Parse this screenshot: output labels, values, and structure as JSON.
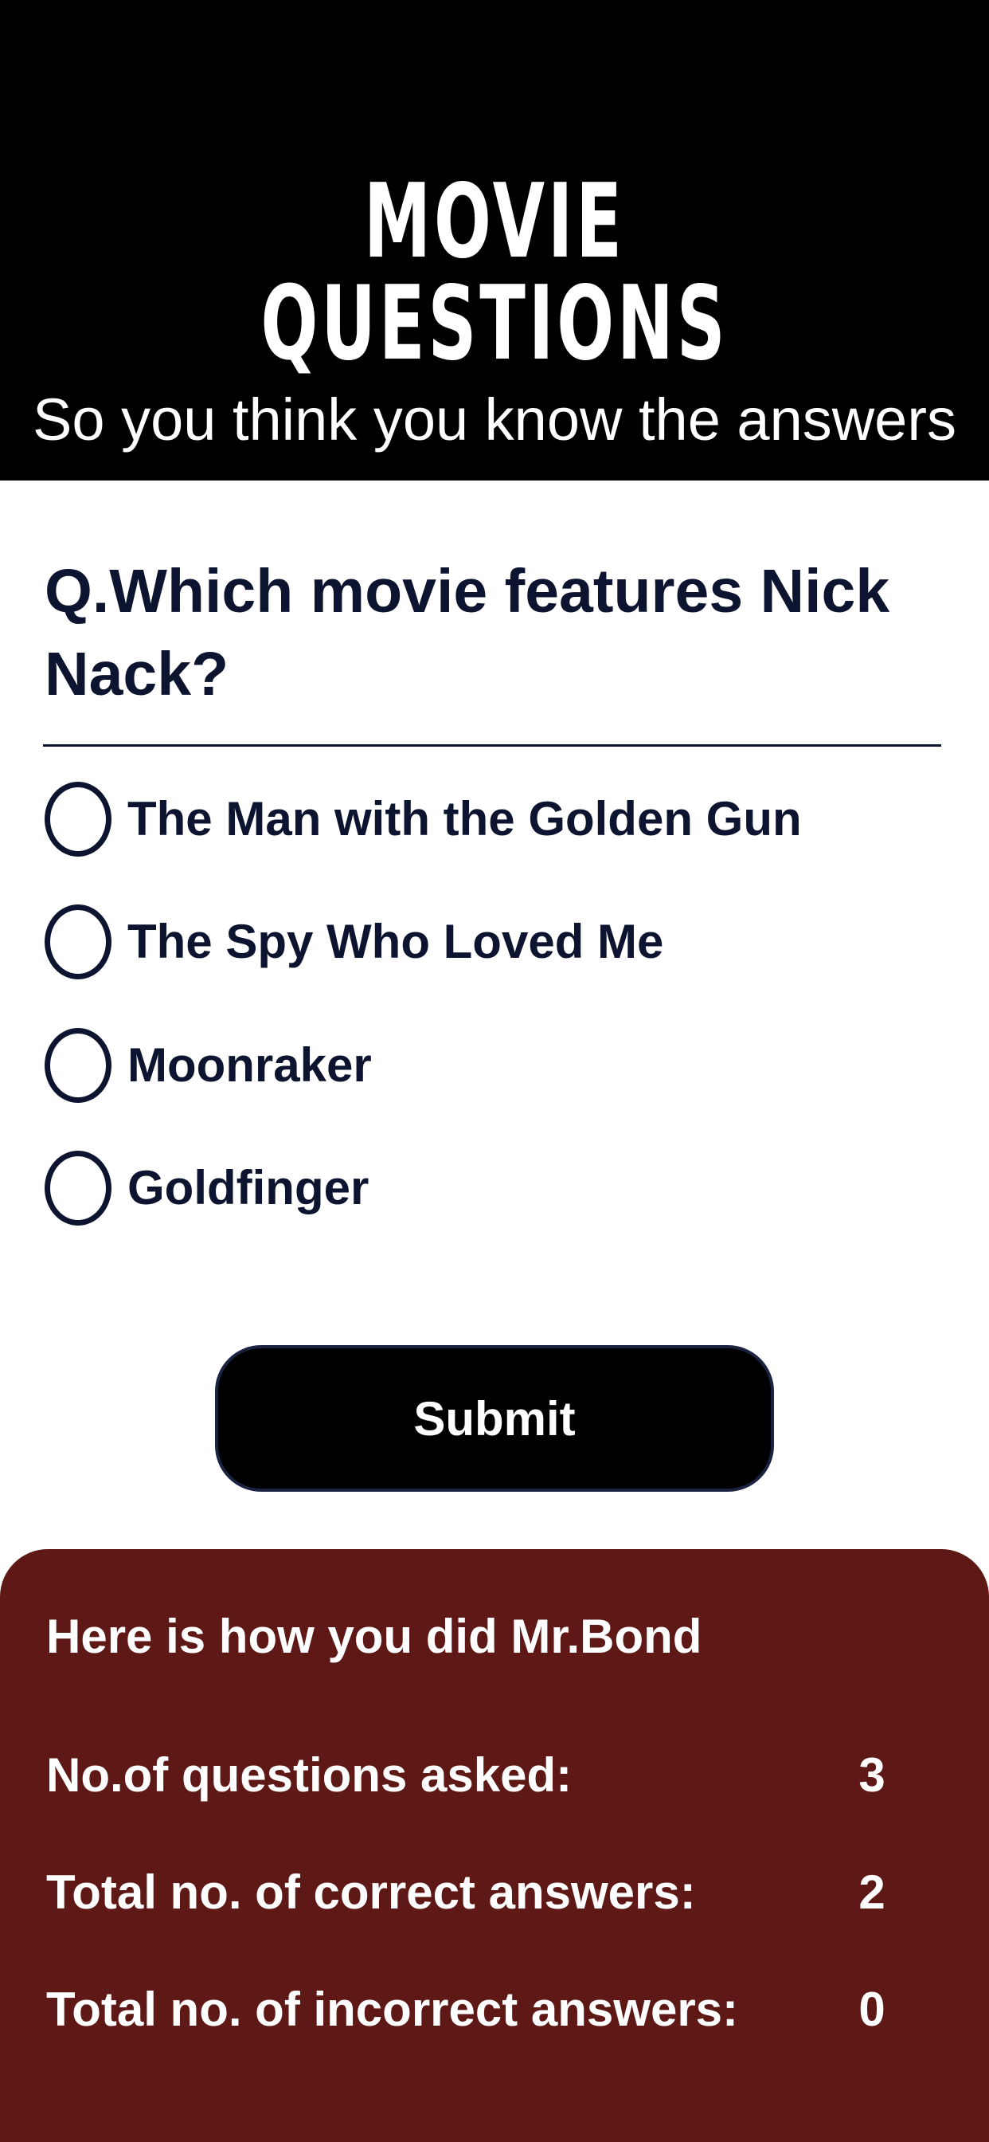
{
  "header": {
    "title": "MOVIE QUESTIONS",
    "subtitle": "So you think you know the answers"
  },
  "question": {
    "text": "Q.Which movie features Nick Nack?",
    "options": [
      {
        "label": "The Man with the Golden Gun",
        "selected": false
      },
      {
        "label": "The Spy Who Loved Me",
        "selected": false
      },
      {
        "label": "Moonraker",
        "selected": false
      },
      {
        "label": "Goldfinger",
        "selected": false
      }
    ]
  },
  "submit": {
    "label": "Submit"
  },
  "results": {
    "heading": "Here is how you did Mr.Bond",
    "stats": [
      {
        "label": "No.of questions asked:",
        "value": "3"
      },
      {
        "label": "Total no. of correct answers:",
        "value": "2"
      },
      {
        "label": "Total no. of incorrect answers:",
        "value": "0"
      }
    ]
  },
  "colors": {
    "header_background": "#000000",
    "text_dark": "#0d1430",
    "results_background": "#5e1916",
    "button_background": "#000000"
  }
}
